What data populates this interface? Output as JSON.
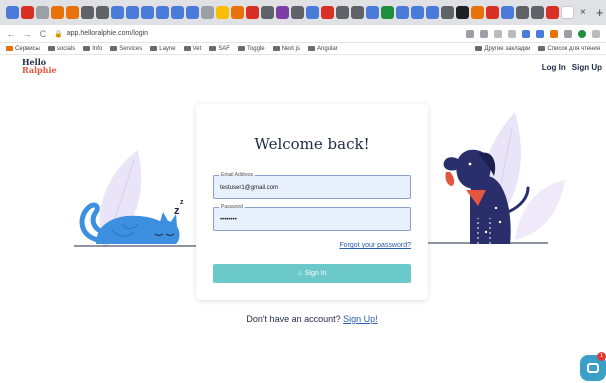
{
  "browser": {
    "tabs": [
      {
        "icon": "diamond-icon",
        "color": "#4a7bd9"
      },
      {
        "icon": "a-icon",
        "color": "#d93025"
      },
      {
        "icon": "circle-icon",
        "color": "#9aa0a6"
      },
      {
        "icon": "bookmark-icon",
        "color": "#e8710a"
      },
      {
        "icon": "bookmark-icon",
        "color": "#e8710a"
      },
      {
        "icon": "link-icon",
        "color": "#5f6368"
      },
      {
        "icon": "circle-icon",
        "color": "#5f6368"
      },
      {
        "icon": "k-icon",
        "color": "#4a7bd9"
      },
      {
        "icon": "k-icon",
        "color": "#4a7bd9"
      },
      {
        "icon": "k-icon",
        "color": "#4a7bd9"
      },
      {
        "icon": "k-icon",
        "color": "#4a7bd9"
      },
      {
        "icon": "k-icon",
        "color": "#4a7bd9"
      },
      {
        "icon": "k-icon",
        "color": "#4a7bd9"
      },
      {
        "icon": "doc-icon",
        "color": "#9aa0a6"
      },
      {
        "icon": "doc-icon",
        "color": "#fbbc04"
      },
      {
        "icon": "image-icon",
        "color": "#e8710a"
      },
      {
        "icon": "image-icon",
        "color": "#d93025"
      },
      {
        "icon": "m-icon",
        "color": "#5f6368"
      },
      {
        "icon": "square-icon",
        "color": "#7b3fa6"
      },
      {
        "icon": "m-icon",
        "color": "#5f6368"
      },
      {
        "icon": "diamond-icon",
        "color": "#4a7bd9"
      },
      {
        "icon": "circle-icon",
        "color": "#d93025"
      },
      {
        "icon": "circle-icon",
        "color": "#5f6368"
      },
      {
        "icon": "circle-icon",
        "color": "#5f6368"
      },
      {
        "icon": "square-icon",
        "color": "#4a7bd9"
      },
      {
        "icon": "circle-icon",
        "color": "#1e8e3e"
      },
      {
        "icon": "diamond-icon",
        "color": "#4a7bd9"
      },
      {
        "icon": "diamond-icon",
        "color": "#4a7bd9"
      },
      {
        "icon": "diamond-icon",
        "color": "#4a7bd9"
      },
      {
        "icon": "square-icon",
        "color": "#5f6368"
      },
      {
        "icon": "square-icon",
        "color": "#202124"
      },
      {
        "icon": "circle-icon",
        "color": "#e8710a"
      },
      {
        "icon": "bookmark-icon",
        "color": "#d93025"
      },
      {
        "icon": "square-icon",
        "color": "#4a7bd9"
      },
      {
        "icon": "circle-icon",
        "color": "#5f6368"
      },
      {
        "icon": "circle-icon",
        "color": "#5f6368"
      },
      {
        "icon": "image-icon",
        "color": "#d93025"
      },
      {
        "icon": "square-icon",
        "color": "#ffffff",
        "active": true
      }
    ],
    "tab_close": "×",
    "tab_new": "+",
    "url": "app.helloralphie.com/login",
    "bookmarks": [
      {
        "label": "Сервисы",
        "icon": "apps-icon"
      },
      {
        "label": "socials",
        "icon": "folder-icon"
      },
      {
        "label": "Info",
        "icon": "folder-icon"
      },
      {
        "label": "Services",
        "icon": "folder-icon"
      },
      {
        "label": "Layne",
        "icon": "folder-icon"
      },
      {
        "label": "Vet",
        "icon": "folder-icon"
      },
      {
        "label": "SAF",
        "icon": "folder-icon"
      },
      {
        "label": "Toggle",
        "icon": "folder-icon"
      },
      {
        "label": "Next.js",
        "icon": "folder-icon"
      },
      {
        "label": "Angular",
        "icon": "folder-icon"
      }
    ],
    "bookmarks_right": [
      {
        "label": "Другие закладки",
        "icon": "folder-icon"
      },
      {
        "label": "Список для чтения",
        "icon": "reading-list-icon"
      }
    ]
  },
  "header": {
    "logo_line1": "Hello",
    "logo_line2": "Ralphie",
    "login_label": "Log In",
    "signup_label": "Sign Up"
  },
  "card": {
    "title": "Welcome back!",
    "email_label": "Email Address",
    "email_value": "testuser1@gmail.com",
    "password_label": "Password",
    "password_value": "••••••••",
    "forgot_label": "Forgot your password?",
    "signin_label": "Sign In"
  },
  "footer": {
    "no_account": "Don't have an account?",
    "signup_link": "Sign Up!"
  },
  "chat": {
    "badge": "1"
  },
  "illustration": {
    "sleep_letters": [
      "z",
      "z"
    ]
  },
  "colors": {
    "accent_teal": "#6cc9c9",
    "brand_navy": "#1f2a44",
    "brand_red": "#e3563f",
    "link_blue": "#2b5fa8",
    "cat_blue": "#3d8fe0",
    "dog_navy": "#2a2f6b",
    "deco_lavender": "#e9e4f7"
  }
}
